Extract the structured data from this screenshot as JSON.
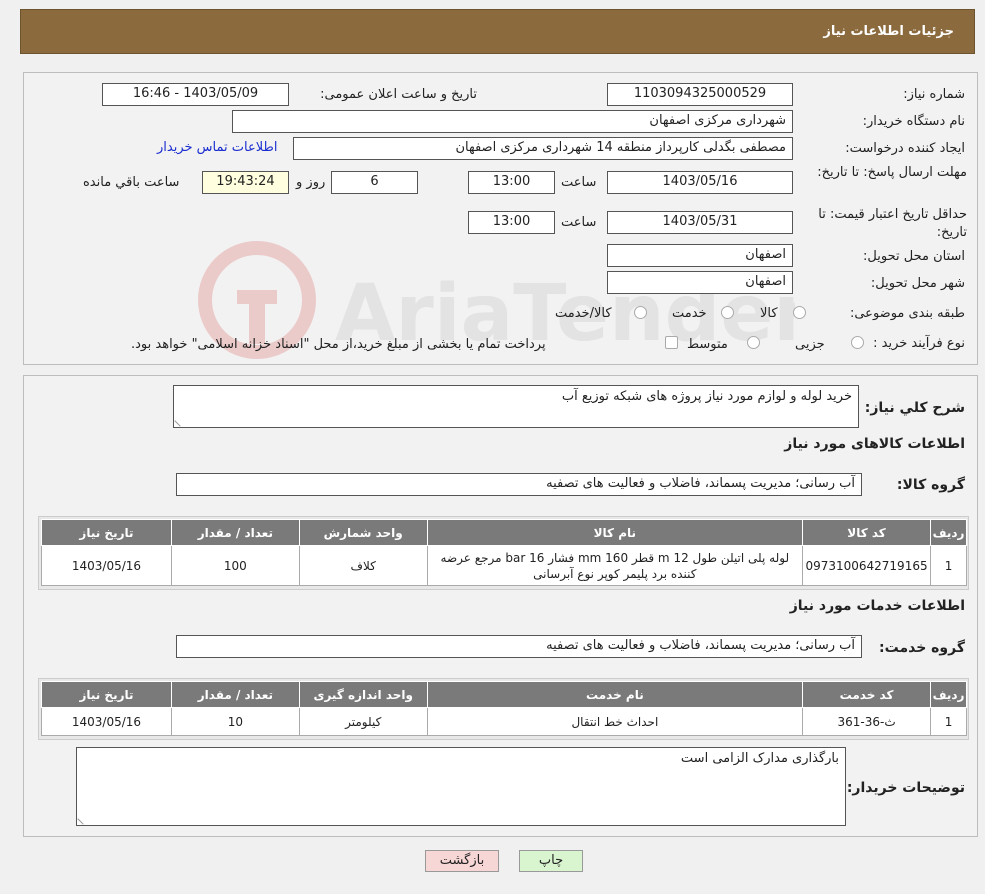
{
  "header": {
    "title": "جزئیات اطلاعات نیاز"
  },
  "form": {
    "need_number_label": "شماره نیاز:",
    "need_number": "1103094325000529",
    "announce_label": "تاریخ و ساعت اعلان عمومی:",
    "announce_value": "1403/05/09 - 16:46",
    "buyer_org_label": "نام دستگاه خریدار:",
    "buyer_org": "شهرداری مرکزی اصفهان",
    "creator_label": "ایجاد کننده درخواست:",
    "creator": "مصطفی بگدلی کارپرداز منطقه 14 شهرداری مرکزی اصفهان",
    "contact_link": "اطلاعات تماس خریدار",
    "deadline_label": "مهلت ارسال پاسخ: تا تاریخ:",
    "deadline_date": "1403/05/16",
    "time_label": "ساعت",
    "deadline_time": "13:00",
    "days_value": "6",
    "days_label": "روز و",
    "remaining_time": "19:43:24",
    "remaining_label": "ساعت باقي مانده",
    "validity_label": "حداقل تاریخ اعتبار قیمت: تا تاریخ:",
    "validity_date": "1403/05/31",
    "validity_time": "13:00",
    "province_label": "استان محل تحویل:",
    "province": "اصفهان",
    "city_label": "شهر محل تحویل:",
    "city": "اصفهان",
    "category_label": "طبقه بندی موضوعی:",
    "category_options": [
      "کالا",
      "خدمت",
      "کالا/خدمت"
    ],
    "process_label": "نوع فرآیند خرید :",
    "process_options": [
      "جزیی",
      "متوسط"
    ],
    "process_note": "پرداخت تمام یا بخشی از مبلغ خرید،از محل \"اسناد خزانه اسلامی\" خواهد بود."
  },
  "description": {
    "label": "شرح كلي نياز:",
    "value": "خرید لوله و لوازم مورد نیاز پروژه های شبکه توزیع آب"
  },
  "goods": {
    "section_title": "اطلاعات کالاهای مورد نیاز",
    "group_label": "گروه کالا:",
    "group_value": "آب رسانی؛ مدیریت پسماند، فاضلاب و فعالیت های تصفیه",
    "columns": [
      "ردیف",
      "کد کالا",
      "نام کالا",
      "واحد شمارش",
      "تعداد / مقدار",
      "تاریخ نیاز"
    ],
    "rows": [
      {
        "row": "1",
        "code": "0973100642719165",
        "name": "لوله پلی اتیلن طول 12 m قطر 160 mm فشار 16 bar مرجع عرضه کننده برد پلیمر کوپر نوع آبرسانی",
        "unit": "کلاف",
        "qty": "100",
        "date": "1403/05/16"
      }
    ]
  },
  "services": {
    "section_title": "اطلاعات خدمات مورد نیاز",
    "group_label": "گروه خدمت:",
    "group_value": "آب رسانی؛ مدیریت پسماند، فاضلاب و فعالیت های تصفیه",
    "columns": [
      "ردیف",
      "کد خدمت",
      "نام خدمت",
      "واحد اندازه گیری",
      "تعداد / مقدار",
      "تاریخ نیاز"
    ],
    "rows": [
      {
        "row": "1",
        "code": "ث-36-361",
        "name": "احداث خط انتقال",
        "unit": "کیلومتر",
        "qty": "10",
        "date": "1403/05/16"
      }
    ]
  },
  "buyer_notes": {
    "label": "توضیحات خریدار:",
    "value": "بارگذاری مدارک الزامی است"
  },
  "buttons": {
    "print": "چاپ",
    "back": "بازگشت"
  },
  "watermark": {
    "text": "AriaTender.neT"
  }
}
